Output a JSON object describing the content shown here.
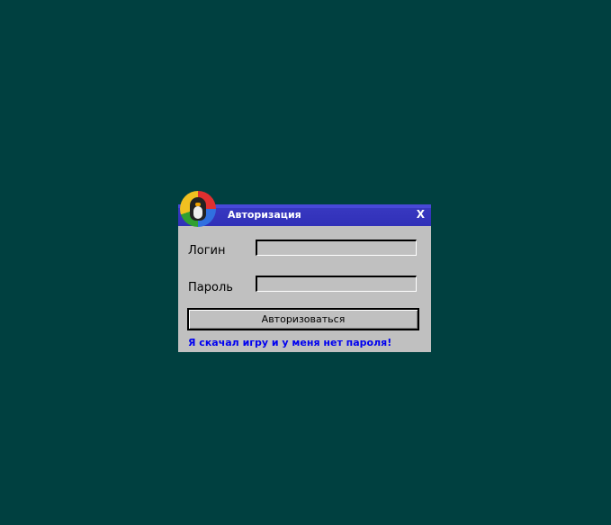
{
  "dialog": {
    "title": "Авторизация",
    "close_label": "X",
    "login_label": "Логин",
    "login_value": "",
    "password_label": "Пароль",
    "password_value": "",
    "submit_label": "Авторизоваться",
    "no_password_link": "Я скачал игру и у меня нет пароля!"
  },
  "colors": {
    "desktop": "#004040",
    "titlebar": "#3434bc",
    "link": "#0000f0"
  },
  "icons": {
    "logo": "penguin-logo-icon"
  }
}
